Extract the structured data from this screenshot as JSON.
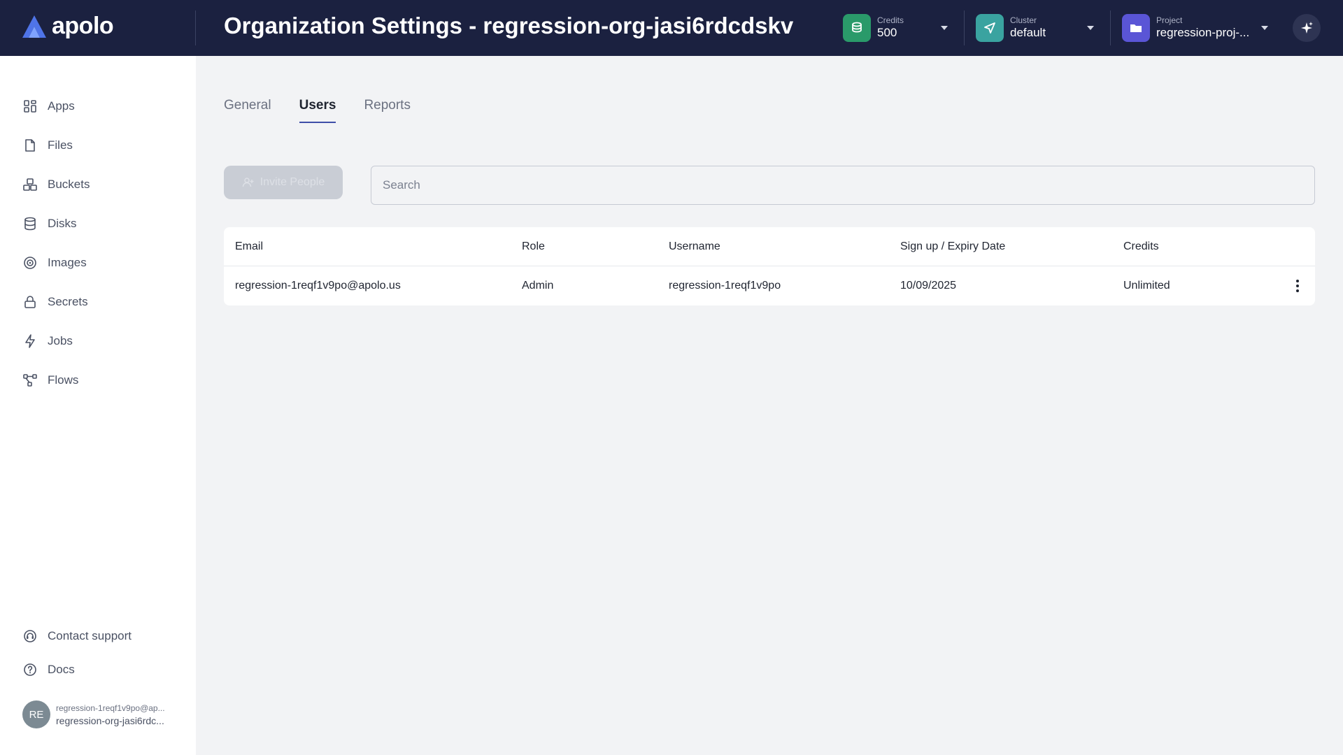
{
  "header": {
    "brand": "apolo",
    "title": "Organization Settings - regression-org-jasi6rdcdskv",
    "credits": {
      "label": "Credits",
      "value": "500",
      "icon": "coins-icon",
      "color": "#2a9a6a"
    },
    "cluster": {
      "label": "Cluster",
      "value": "default",
      "icon": "send-icon",
      "color": "#3aa3a0"
    },
    "project": {
      "label": "Project",
      "value": "regression-proj-...",
      "icon": "folder-icon",
      "color": "#5a55d6"
    },
    "ai_icon": "sparkles-icon"
  },
  "sidebar": {
    "items": [
      {
        "label": "Apps",
        "icon": "apps-grid-icon"
      },
      {
        "label": "Files",
        "icon": "file-icon"
      },
      {
        "label": "Buckets",
        "icon": "buckets-icon"
      },
      {
        "label": "Disks",
        "icon": "database-icon"
      },
      {
        "label": "Images",
        "icon": "image-disc-icon"
      },
      {
        "label": "Secrets",
        "icon": "lock-icon"
      },
      {
        "label": "Jobs",
        "icon": "lightning-icon"
      },
      {
        "label": "Flows",
        "icon": "flow-icon"
      }
    ],
    "bottom": [
      {
        "label": "Contact support",
        "icon": "headset-icon"
      },
      {
        "label": "Docs",
        "icon": "help-circle-icon"
      }
    ],
    "user": {
      "initials": "RE",
      "email": "regression-1reqf1v9po@ap...",
      "org": "regression-org-jasi6rdc..."
    }
  },
  "tabs": [
    {
      "label": "General",
      "active": false
    },
    {
      "label": "Users",
      "active": true
    },
    {
      "label": "Reports",
      "active": false
    }
  ],
  "toolbar": {
    "invite_label": "Invite People",
    "search_placeholder": "Search"
  },
  "table": {
    "columns": [
      "Email",
      "Role",
      "Username",
      "Sign up / Expiry Date",
      "Credits"
    ],
    "rows": [
      {
        "email": "regression-1reqf1v9po@apolo.us",
        "role": "Admin",
        "username": "regression-1reqf1v9po",
        "date": "10/09/2025",
        "credits": "Unlimited"
      }
    ]
  },
  "colors": {
    "header_bg": "#1b2140",
    "accent": "#3f4fa8",
    "sidebar_bg": "#ffffff",
    "page_bg": "#f2f3f5"
  }
}
